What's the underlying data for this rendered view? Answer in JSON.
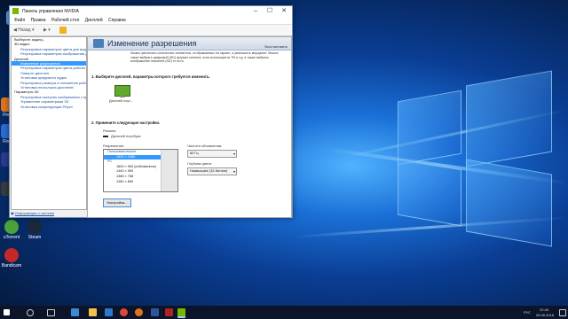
{
  "window": {
    "title": "Панель управления NVIDIA",
    "menu": [
      "Файл",
      "Правка",
      "Рабочий стол",
      "Дисплей",
      "Справка"
    ],
    "back_label": "Назад",
    "select_task_label": "Выберите задачу...",
    "tree": [
      {
        "label": "3D-видео",
        "level": 0
      },
      {
        "label": "Регулировка параметров цвета для видео",
        "level": 1
      },
      {
        "label": "Регулировка параметров изображения для видео",
        "level": 1
      },
      {
        "label": "Дисплей",
        "level": 0
      },
      {
        "label": "Изменение разрешения",
        "level": 1,
        "selected": true
      },
      {
        "label": "Регулировка параметров цвета рабочего стола",
        "level": 1
      },
      {
        "label": "Поворот дисплея",
        "level": 1
      },
      {
        "label": "Установка цифрового аудио",
        "level": 1
      },
      {
        "label": "Регулировка размера и положения рабочего стола",
        "level": 1
      },
      {
        "label": "Установка нескольких дисплеев",
        "level": 1
      },
      {
        "label": "Параметры 3D",
        "level": 0
      },
      {
        "label": "Регулировка настроек изображения с просмотром",
        "level": 1
      },
      {
        "label": "Управление параметрами 3D",
        "level": 1
      },
      {
        "label": "Установка конфигурации PhysX",
        "level": 1
      }
    ],
    "system_info_link": "Информация о системе"
  },
  "content": {
    "heading": "Изменение разрешения",
    "restore_link": "Восстановить",
    "description": "Можно увеличить количество элементов, отображаемых на экране, и уменьшить мерцание. Можно также выбрать цифровой (HD) формат сигнала, если используется ТВ и т.д. а также выбрать изображение пикселей (SD) то есть.",
    "step1": "1. Выберите дисплей, параметры которого требуется изменить.",
    "display_name": "Дисплей ноут...",
    "step2": "2. Примените следующие настройки.",
    "connection_label": "Разъем:",
    "connection_value": "Дисплей ноутбука",
    "resolution_label": "Разрешение:",
    "resolution_list": [
      {
        "label": "Пользовательское",
        "group": true
      },
      {
        "label": "1920 × 1080",
        "selected": true
      },
      {
        "label": "PC",
        "group": true
      },
      {
        "label": "1600 × 900 (собственное)"
      },
      {
        "label": "1440 × 900"
      },
      {
        "label": "1366 × 768"
      },
      {
        "label": "1280 × 800"
      }
    ],
    "refresh_label": "Частота обновления:",
    "refresh_value": "60 Гц",
    "depth_label": "Глубина цвета:",
    "depth_value": "Наивысшее (32-битное)",
    "customize_button": "Настройка..."
  },
  "desktop_icons": [
    {
      "label": "",
      "color": "#5aa0e0"
    },
    {
      "label": "Fire..",
      "color": "#e0741e"
    },
    {
      "label": "Fire..",
      "color": "#2a6bd4"
    },
    {
      "label": "",
      "color": "#2a3b8f"
    },
    {
      "label": "",
      "color": "#3a3a3a"
    },
    {
      "label": "uTorrent",
      "color": "#4aa43a"
    },
    {
      "label": "Steam",
      "color": "#1b2838"
    },
    {
      "label": "Bandicam",
      "color": "#c62828"
    }
  ],
  "taskbar": {
    "tray_lang": "РУС",
    "time": "22:46",
    "date": "06.06.2016"
  }
}
